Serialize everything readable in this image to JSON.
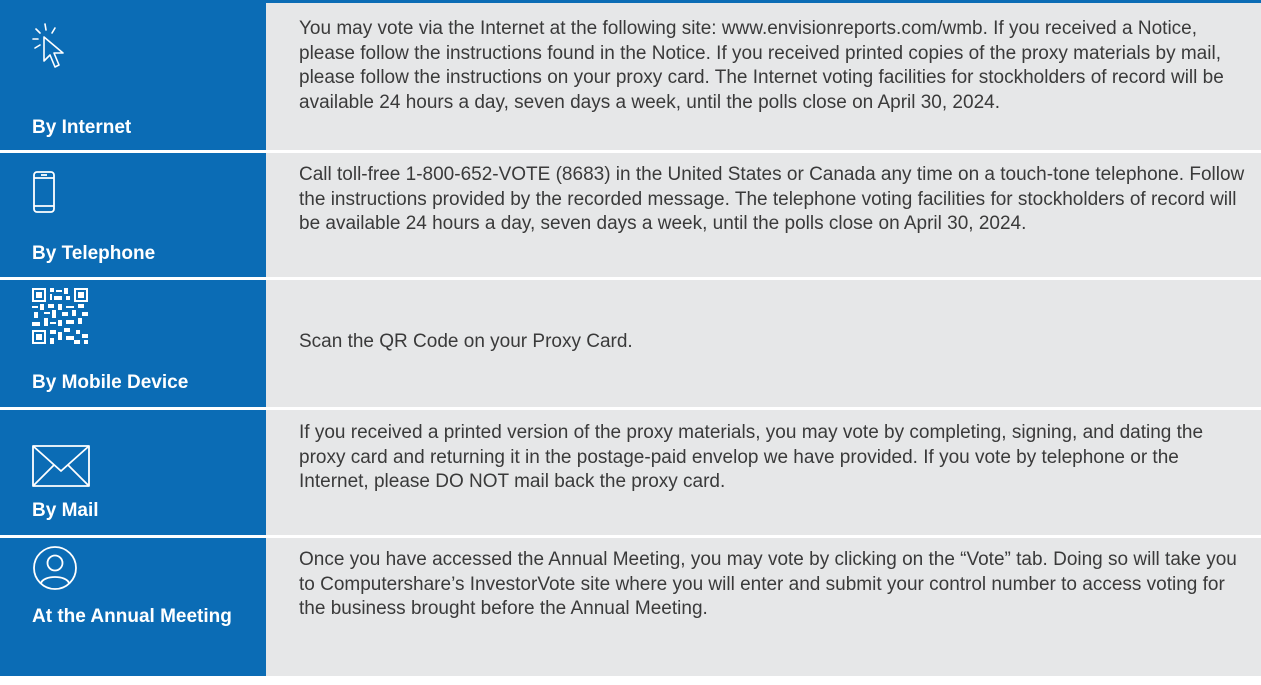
{
  "colors": {
    "accent": "#0B6CB5",
    "band": "#E6E7E8",
    "text": "#3A3A3A",
    "label_text": "#FFFFFF"
  },
  "rows": [
    {
      "label": "By Internet",
      "icon": "cursor-click-icon",
      "text": "You may vote via the Internet at the following site: www.envisionreports.com/wmb. If you received a Notice, please follow the instructions found in the Notice. If you received printed copies of the proxy materials by mail, please follow the instructions on your proxy card. The Internet voting facilities for stockholders of record will be available 24 hours a day, seven days a week, until the polls close on April 30, 2024."
    },
    {
      "label": "By Telephone",
      "icon": "mobile-phone-icon",
      "text": "Call toll-free 1-800-652-VOTE (8683) in the United States or Canada any time on a touch-tone telephone. Follow the instructions provided by the recorded message. The telephone voting facilities for stockholders of record will be available 24 hours a day, seven days a week, until the polls close on April 30, 2024."
    },
    {
      "label": "By Mobile Device",
      "icon": "qr-code-icon",
      "text": "Scan the QR Code on your Proxy Card."
    },
    {
      "label": "By Mail",
      "icon": "envelope-icon",
      "text": "If you received a printed version of the proxy materials, you may vote by completing, signing, and dating the proxy card and returning it in the postage-paid envelop we have provided. If you vote by telephone or the Internet, please DO NOT mail back the proxy card."
    },
    {
      "label": "At the Annual Meeting",
      "icon": "user-circle-icon",
      "text": "Once you have accessed the Annual Meeting, you may vote by clicking on the “Vote” tab. Doing so will take you to Computershare’s InvestorVote site where you will enter and submit your control number to access voting for the business brought before the Annual Meeting."
    }
  ]
}
